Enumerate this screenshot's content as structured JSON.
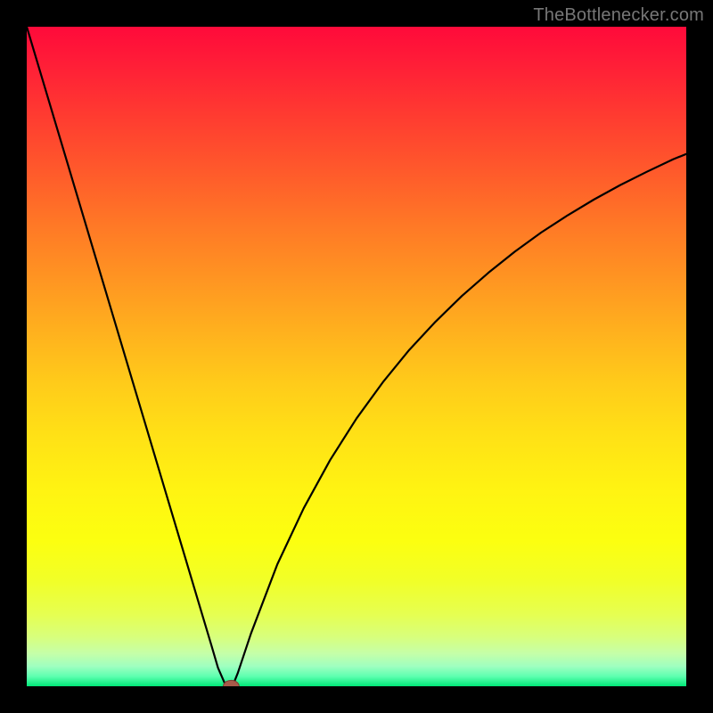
{
  "attribution": {
    "text": "TheBottlenecker.com"
  },
  "colors": {
    "background": "#000000",
    "curve": "#000000",
    "marker_fill": "#a85a4a",
    "marker_stroke": "#7d3e33"
  },
  "chart_data": {
    "type": "line",
    "title": "",
    "xlabel": "",
    "ylabel": "",
    "xlim": [
      0,
      100
    ],
    "ylim": [
      0,
      100
    ],
    "grid": false,
    "series": [
      {
        "name": "bottleneck-curve",
        "x": [
          0,
          2,
          4,
          6,
          8,
          10,
          12,
          14,
          16,
          18,
          20,
          22,
          24,
          26,
          28,
          29,
          30,
          30.8,
          31.2,
          32,
          34,
          38,
          42,
          46,
          50,
          54,
          58,
          62,
          66,
          70,
          74,
          78,
          82,
          86,
          90,
          94,
          98,
          100
        ],
        "values": [
          100,
          93.3,
          86.6,
          79.9,
          73.2,
          66.5,
          59.8,
          53.1,
          46.4,
          39.7,
          33.0,
          26.3,
          19.6,
          12.9,
          6.2,
          2.8,
          0.5,
          0.0,
          0.0,
          2.0,
          8.0,
          18.5,
          27.0,
          34.3,
          40.6,
          46.1,
          51.0,
          55.3,
          59.2,
          62.7,
          65.9,
          68.8,
          71.4,
          73.8,
          76.0,
          78.0,
          79.9,
          80.7
        ]
      }
    ],
    "marker": {
      "x": 31,
      "y": 0,
      "rx": 1.2,
      "ry": 0.9,
      "label": "optimum-point"
    }
  }
}
